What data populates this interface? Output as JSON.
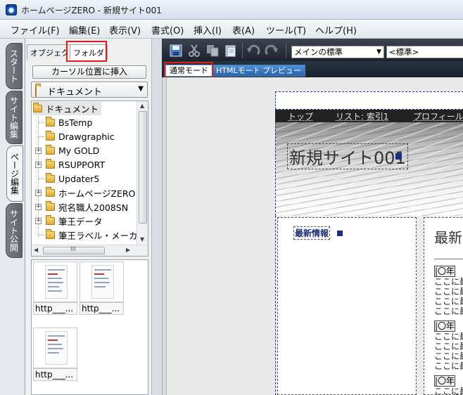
{
  "window": {
    "title": "ホームページZERO - 新規サイト001"
  },
  "menu": [
    "ファイル(F)",
    "編集(E)",
    "表示(V)",
    "書式(O)",
    "挿入(I)",
    "表(A)",
    "ツール(T)",
    "ヘルプ(H)"
  ],
  "vertical_tabs": [
    "スタート",
    "サイト編集",
    "ページ編集",
    "サイト公開"
  ],
  "left_panel": {
    "tabs": [
      "オブジェクト",
      "フォルダ"
    ],
    "insert_button": "カーソル位置に挿入",
    "folder_select": "ドキュメント",
    "tree_root": "ドキュメント",
    "tree_items": [
      "BsTemp",
      "Drawgraphic",
      "My GOLD",
      "RSUPPORT",
      "Updater5",
      "ホームページZERO",
      "宛名職人2008SN",
      "筆王データ",
      "筆王ラベル・メーカ"
    ],
    "hscroll_grip": "III",
    "thumbnails": [
      "http___...",
      "http___...",
      "http___..."
    ]
  },
  "toolbar": {
    "style_select": "メインの標準",
    "format_select": "<標準>"
  },
  "mode_tabs": [
    "通常モード",
    "HTMLモード",
    "プレビュー"
  ],
  "page": {
    "nav_items": [
      "トップ",
      "リスト: 索引1",
      "プロフィール"
    ],
    "site_title": "新規サイト001",
    "sidebar_title": "最新情報",
    "main_title": "最新",
    "entries": [
      {
        "date": "|〇年",
        "lines": [
          "ここに最",
          "ここに最",
          "ここに最",
          "ここに最"
        ]
      },
      {
        "date": "|〇年",
        "lines": [
          "ここに最",
          "ここに最",
          "ここに最",
          "ここに最"
        ]
      },
      {
        "date": "|〇年",
        "lines": [
          "ここに最",
          "ここに最"
        ]
      }
    ]
  },
  "colors": {
    "highlight_box": "#e21b1b",
    "toolbar_bg": "#1e232c",
    "page_guides": "#1b2fa8"
  }
}
